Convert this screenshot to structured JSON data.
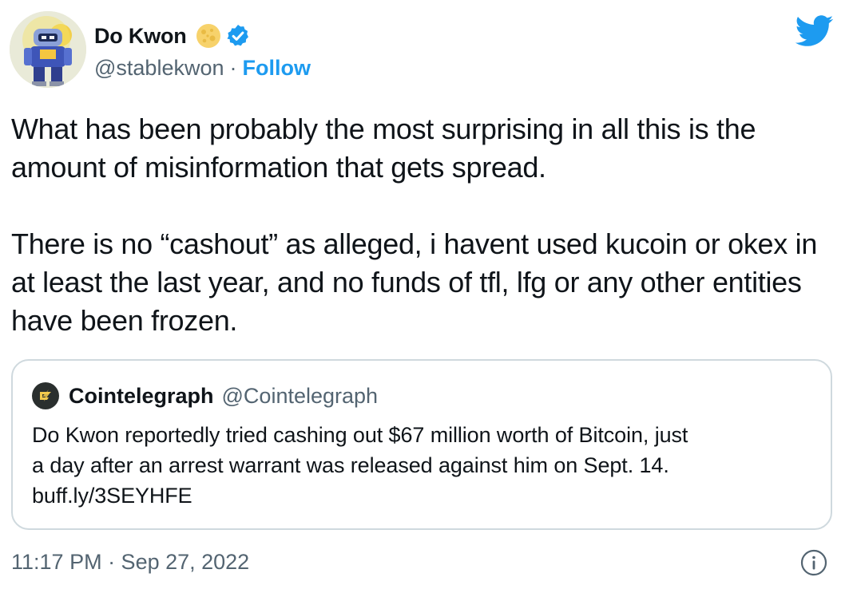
{
  "author": {
    "display_name": "Do Kwon",
    "handle": "@stablekwon",
    "separator": "·",
    "follow_label": "Follow",
    "name_emoji_icon": "moon-icon",
    "verified_icon": "verified-badge-icon"
  },
  "platform_icon": "twitter-bird-icon",
  "tweet": {
    "paragraphs": [
      "What has been probably the most surprising in all this is the amount of misinformation that gets spread.",
      "There is no “cashout” as alleged, i havent used kucoin or okex in at least the last year, and no funds of tfl, lfg or any other entities have been frozen."
    ]
  },
  "quoted_tweet": {
    "display_name": "Cointelegraph",
    "handle": "@Cointelegraph",
    "text_lines": [
      "Do Kwon reportedly tried cashing out $67 million worth of Bitcoin, just",
      "a day after an arrest warrant was released against him on Sept. 14.",
      "buff.ly/3SEYHFE"
    ]
  },
  "timestamp": "11:17 PM · Sep 27, 2022",
  "colors": {
    "accent": "#1d9bf0",
    "text": "#0f1419",
    "secondary_text": "#536471",
    "border": "#cfd9de"
  }
}
